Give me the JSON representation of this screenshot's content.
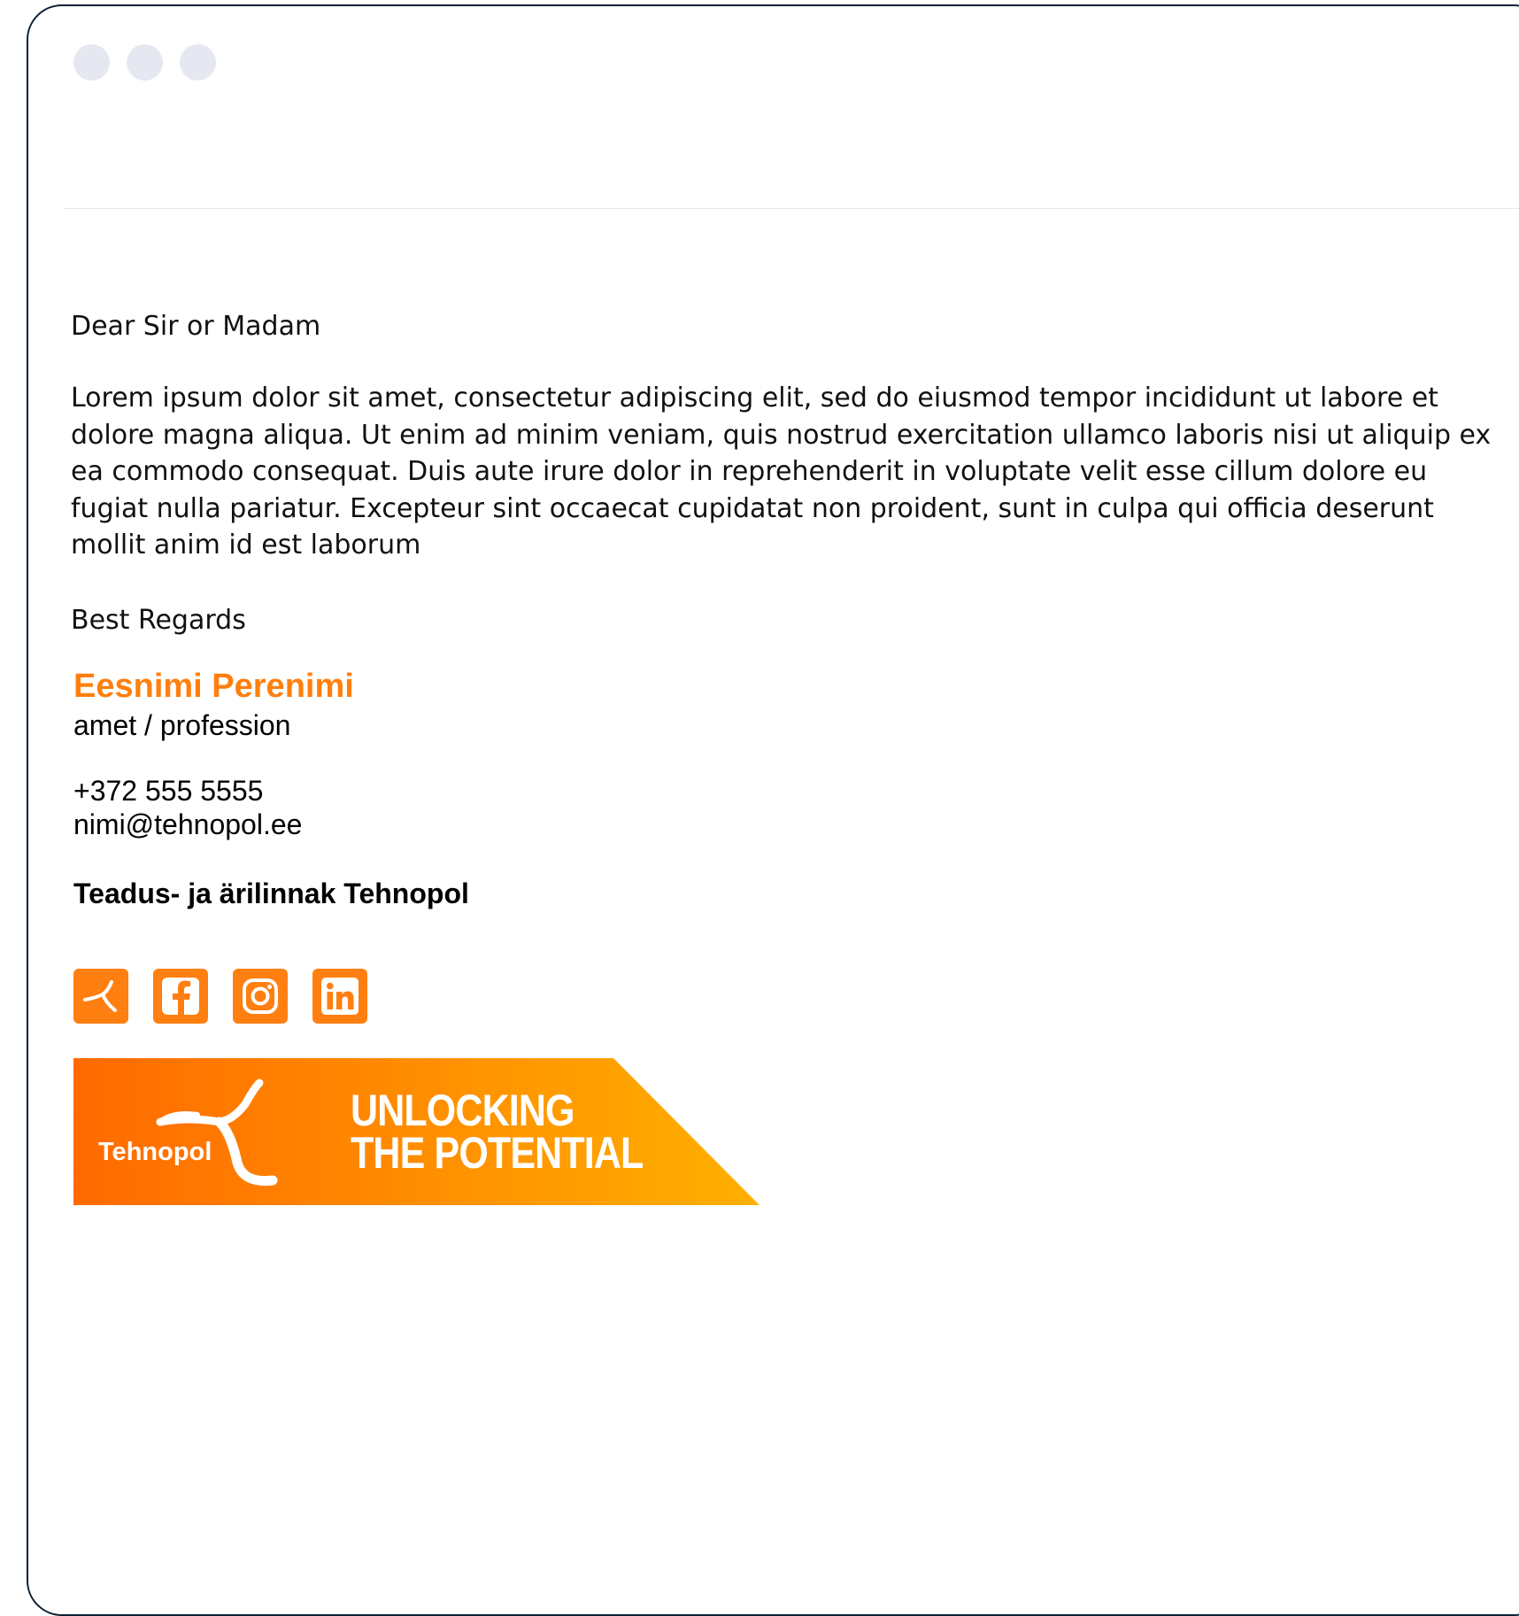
{
  "window": {
    "controls": [
      "control-dot",
      "control-dot",
      "control-dot"
    ]
  },
  "email": {
    "greeting": "Dear Sir or Madam",
    "paragraph": "Lorem ipsum dolor sit amet, consectetur adipiscing elit, sed do eiusmod tempor incididunt ut labore et dolore magna aliqua. Ut enim ad minim veniam, quis nostrud exercitation ullamco laboris nisi ut aliquip ex ea commodo consequat. Duis aute irure dolor in reprehenderit in voluptate velit esse cillum dolore eu fugiat nulla pariatur. Excepteur sint occaecat cupidatat non proident, sunt in culpa qui officia deserunt mollit anim id est laborum",
    "closing": "Best Regards"
  },
  "signature": {
    "name": "Eesnimi Perenimi",
    "role": "amet / profession",
    "phone": "+372 555 5555",
    "email": "nimi@tehnopol.ee",
    "company": "Teadus- ja ärilinnak Tehnopol",
    "accent_color": "#ff7f0e"
  },
  "social": {
    "icons": [
      "tehnopol-icon",
      "facebook-icon",
      "instagram-icon",
      "linkedin-icon"
    ]
  },
  "banner": {
    "brand": "Tehnopol",
    "line1": "UNLOCKING",
    "line2": "THE POTENTIAL",
    "gradient_start": "#ff6a00",
    "gradient_end": "#ffb000"
  }
}
